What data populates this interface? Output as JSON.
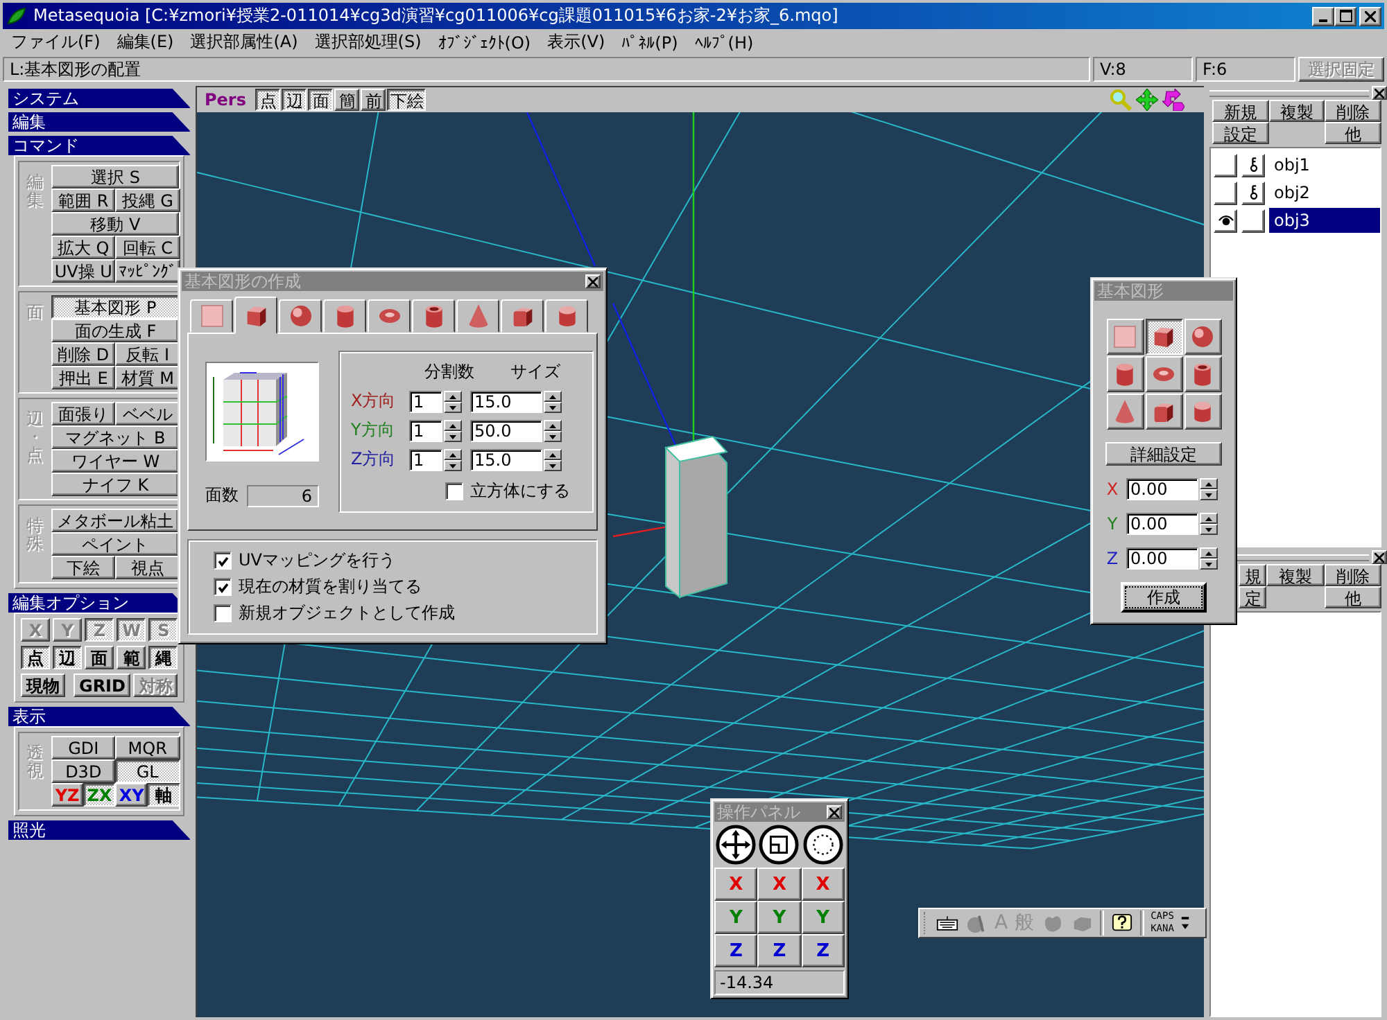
{
  "window": {
    "title": "Metasequoia [C:¥zmori¥授業2-011014¥cg3d演習¥cg011006¥cg課題011015¥6お家-2¥お家_6.mqo]"
  },
  "menu": [
    "ファイル(F)",
    "編集(E)",
    "選択部属性(A)",
    "選択部処理(S)",
    "ｵﾌﾞｼﾞｪｸﾄ(O)",
    "表示(V)",
    "ﾊﾟﾈﾙ(P)",
    "ﾍﾙﾌﾟ(H)"
  ],
  "status": {
    "hint": "L:基本図形の配置",
    "vertices": "V:8",
    "faces": "F:6",
    "lock": {
      "label": "選択固定",
      "disabled": true
    }
  },
  "sidebar": {
    "sections": [
      {
        "title": "システム"
      },
      {
        "title": "編集"
      },
      {
        "title": "コマンド",
        "groups": [
          {
            "label": "編集",
            "rows": [
              [
                {
                  "label": "選択 S",
                  "pressed": false
                }
              ],
              [
                {
                  "label": "範囲 R",
                  "pressed": false
                },
                {
                  "label": "投縄 G",
                  "pressed": false
                }
              ],
              [
                {
                  "label": "移動 V",
                  "pressed": false
                }
              ],
              [
                {
                  "label": "拡大 Q",
                  "pressed": false
                },
                {
                  "label": "回転 C",
                  "pressed": false
                }
              ],
              [
                {
                  "label": "UV操 U",
                  "pressed": false
                },
                {
                  "label": "ﾏｯﾋﾟﾝｸﾞ",
                  "pressed": false
                }
              ]
            ]
          },
          {
            "label": "面",
            "rows": [
              [
                {
                  "label": "基本図形 P",
                  "pressed": true
                }
              ],
              [
                {
                  "label": "面の生成 F",
                  "pressed": false
                }
              ],
              [
                {
                  "label": "削除 D",
                  "pressed": false
                },
                {
                  "label": "反転 I",
                  "pressed": false
                }
              ],
              [
                {
                  "label": "押出 E",
                  "pressed": false
                },
                {
                  "label": "材質 M",
                  "pressed": false
                }
              ]
            ]
          },
          {
            "label": "辺・点",
            "rows": [
              [
                {
                  "label": "面張り",
                  "pressed": false
                },
                {
                  "label": "ベベル",
                  "pressed": false
                }
              ],
              [
                {
                  "label": "マグネット B",
                  "pressed": false
                }
              ],
              [
                {
                  "label": "ワイヤー W",
                  "pressed": false
                }
              ],
              [
                {
                  "label": "ナイフ K",
                  "pressed": false
                }
              ]
            ]
          },
          {
            "label": "特殊",
            "rows": [
              [
                {
                  "label": "メタボール粘土",
                  "pressed": false
                }
              ],
              [
                {
                  "label": "ペイント",
                  "pressed": false
                }
              ],
              [
                {
                  "label": "下絵",
                  "pressed": false
                },
                {
                  "label": "視点",
                  "pressed": false
                }
              ]
            ]
          }
        ]
      },
      {
        "title": "編集オプション",
        "rows": [
          [
            {
              "label": "X",
              "pressed": false,
              "disabled": true
            },
            {
              "label": "Y",
              "pressed": false,
              "disabled": true
            },
            {
              "label": "Z",
              "pressed": true,
              "disabled": true
            },
            {
              "label": "W",
              "pressed": true,
              "disabled": true
            },
            {
              "label": "S",
              "pressed": true,
              "disabled": true
            }
          ],
          [
            {
              "label": "点",
              "pressed": true,
              "disabled": false
            },
            {
              "label": "辺",
              "pressed": true,
              "disabled": false
            },
            {
              "label": "面",
              "pressed": false,
              "disabled": false
            },
            {
              "label": "範",
              "pressed": false,
              "disabled": false
            },
            {
              "label": "縄",
              "pressed": true,
              "disabled": false
            }
          ]
        ],
        "extras": [
          {
            "label": "現物",
            "pressed": false,
            "disabled": false
          },
          {
            "label": "GRID",
            "pressed": false,
            "disabled": false
          },
          {
            "label": "対称",
            "pressed": false,
            "disabled": true
          }
        ]
      },
      {
        "title": "表示",
        "groups": [
          {
            "label": "透視",
            "rows": [
              [
                {
                  "label": "GDI",
                  "pressed": false
                },
                {
                  "label": "MQR",
                  "pressed": false
                }
              ],
              [
                {
                  "label": "D3D",
                  "pressed": false
                },
                {
                  "label": "GL",
                  "pressed": true
                }
              ],
              [
                {
                  "label": "YZ",
                  "pressed": false,
                  "color": "#e00000"
                },
                {
                  "label": "ZX",
                  "pressed": true,
                  "color": "#008000"
                },
                {
                  "label": "XY",
                  "pressed": false,
                  "color": "#0000e0"
                },
                {
                  "label": "軸",
                  "pressed": true,
                  "color": "#000000"
                }
              ]
            ]
          }
        ]
      },
      {
        "title": "照光"
      }
    ]
  },
  "viewport": {
    "mode": "Pers",
    "toggles": [
      {
        "label": "点",
        "pressed": true
      },
      {
        "label": "辺",
        "pressed": true
      },
      {
        "label": "面",
        "pressed": true
      },
      {
        "label": "簡",
        "pressed": false
      },
      {
        "label": "前",
        "pressed": false
      },
      {
        "label": "下絵",
        "pressed": true
      }
    ]
  },
  "object_panel": {
    "buttons": [
      "新規",
      "複製",
      "削除",
      "設定",
      "他"
    ],
    "objects": [
      {
        "name": "obj1",
        "visible": false,
        "locked": true,
        "selected": false
      },
      {
        "name": "obj2",
        "visible": false,
        "locked": true,
        "selected": false
      },
      {
        "name": "obj3",
        "visible": true,
        "locked": false,
        "selected": true
      }
    ]
  },
  "material_panel": {
    "buttons": [
      "規",
      "複製",
      "削除",
      "定",
      "他"
    ]
  },
  "create_dialog": {
    "title": "基本図形の作成",
    "tabs": [
      {
        "kind": "plane",
        "selected": false
      },
      {
        "kind": "cube",
        "selected": true
      },
      {
        "kind": "sphere",
        "selected": false
      },
      {
        "kind": "cylinder",
        "selected": false
      },
      {
        "kind": "torus",
        "selected": false
      },
      {
        "kind": "pipe",
        "selected": false
      },
      {
        "kind": "cone",
        "selected": false
      },
      {
        "kind": "roundbox",
        "selected": false
      },
      {
        "kind": "capsule",
        "selected": false
      }
    ],
    "face_count_label": "面数",
    "face_count": "6",
    "headers": [
      "分割数",
      "サイズ"
    ],
    "axes": [
      {
        "label": "X方向",
        "color": "#a02020",
        "divisions": "1",
        "size": "15.0"
      },
      {
        "label": "Y方向",
        "color": "#208020",
        "divisions": "1",
        "size": "50.0"
      },
      {
        "label": "Z方向",
        "color": "#2020a0",
        "divisions": "1",
        "size": "15.0"
      }
    ],
    "cube_option": {
      "label": "立方体にする",
      "checked": false
    },
    "options": [
      {
        "label": "UVマッピングを行う",
        "checked": true
      },
      {
        "label": "現在の材質を割り当てる",
        "checked": true
      },
      {
        "label": "新規オブジェクトとして作成",
        "checked": false
      }
    ]
  },
  "shape_panel": {
    "title": "基本図形",
    "shapes": [
      {
        "kind": "plane",
        "selected": false
      },
      {
        "kind": "cube",
        "selected": true
      },
      {
        "kind": "sphere",
        "selected": false
      },
      {
        "kind": "cylinder",
        "selected": false
      },
      {
        "kind": "torus",
        "selected": false
      },
      {
        "kind": "pipe",
        "selected": false
      },
      {
        "kind": "cone",
        "selected": false
      },
      {
        "kind": "roundbox",
        "selected": false
      },
      {
        "kind": "capsule",
        "selected": false
      }
    ],
    "detail_button": "詳細設定",
    "coords": [
      {
        "label": "X",
        "color": "#d02020",
        "value": "0.00"
      },
      {
        "label": "Y",
        "color": "#208020",
        "value": "0.00"
      },
      {
        "label": "Z",
        "color": "#2020c0",
        "value": "0.00"
      }
    ],
    "create_button": "作成"
  },
  "op_panel": {
    "title": "操作パネル",
    "rows": [
      {
        "color": "#e00000",
        "buttons": [
          "X",
          "X",
          "X"
        ]
      },
      {
        "color": "#008000",
        "buttons": [
          "Y",
          "Y",
          "Y"
        ]
      },
      {
        "color": "#0000d0",
        "buttons": [
          "Z",
          "Z",
          "Z"
        ]
      }
    ],
    "value": "-14.34"
  },
  "ime_bar": {
    "alpha": "A",
    "kanji": "般",
    "caps": "CAPS",
    "kana": "KANA"
  }
}
